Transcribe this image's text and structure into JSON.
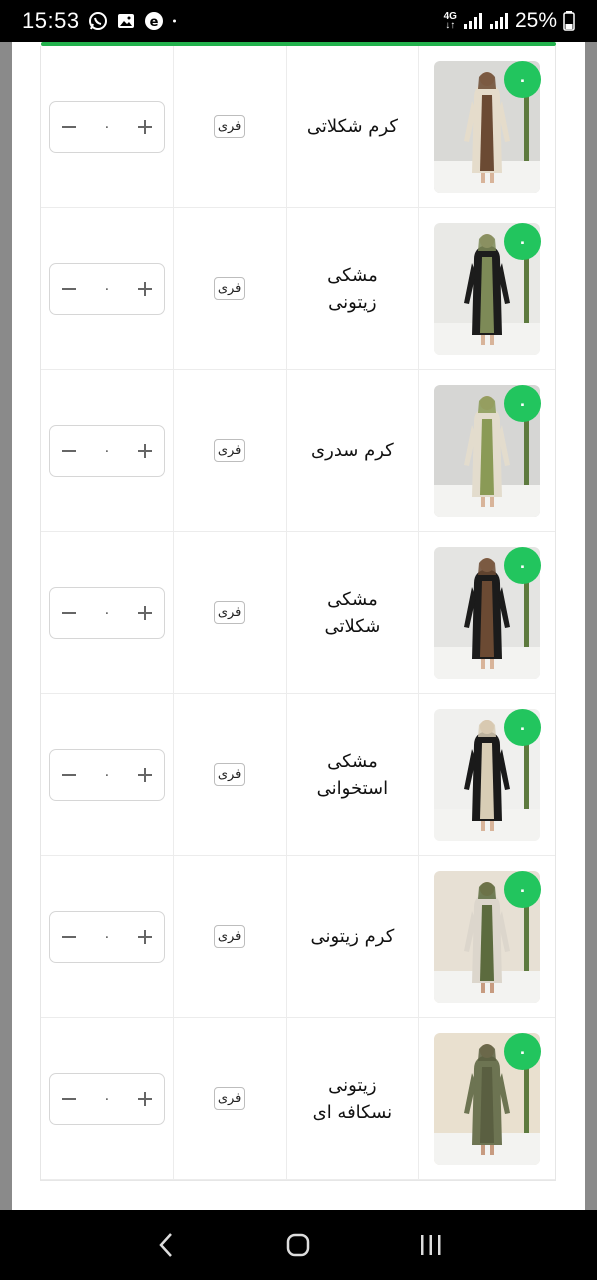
{
  "status": {
    "time": "15:53",
    "network": "4G",
    "battery": "25%"
  },
  "products": [
    {
      "name": "کرم شکلاتی",
      "size": "فری",
      "badge": "۰",
      "qty": "۰",
      "colors": {
        "bg": "#d9d9d6",
        "coat": "#e5dccb",
        "trim": "#6b4a33",
        "skin": "#d8b49a"
      }
    },
    {
      "name": "مشکی زیتونی",
      "size": "فری",
      "badge": "۰",
      "qty": "۰",
      "colors": {
        "bg": "#e9e9e6",
        "coat": "#1c1c1c",
        "trim": "#7d8a57",
        "skin": "#d8b49a"
      }
    },
    {
      "name": "کرم سدری",
      "size": "فری",
      "badge": "۰",
      "qty": "۰",
      "colors": {
        "bg": "#d6d6d4",
        "coat": "#e3dccd",
        "trim": "#8a9a56",
        "skin": "#d8b49a"
      }
    },
    {
      "name": "مشکی شکلاتی",
      "size": "فری",
      "badge": "۰",
      "qty": "۰",
      "colors": {
        "bg": "#e4e4e2",
        "coat": "#1b1b1b",
        "trim": "#6b4a33",
        "skin": "#d8b49a"
      }
    },
    {
      "name": "مشکی استخوانی",
      "size": "فری",
      "badge": "۰",
      "qty": "۰",
      "colors": {
        "bg": "#f0f0ee",
        "coat": "#1a1a1a",
        "trim": "#d8cdb5",
        "skin": "#d8b49a"
      }
    },
    {
      "name": "کرم زیتونی",
      "size": "فری",
      "badge": "۰",
      "qty": "۰",
      "colors": {
        "bg": "#e7e0d4",
        "coat": "#dcd6cc",
        "trim": "#5c6b3e",
        "skin": "#c79b80"
      }
    },
    {
      "name": "زیتونی نسکافه ای",
      "size": "فری",
      "badge": "۰",
      "qty": "۰",
      "colors": {
        "bg": "#e9e0cf",
        "coat": "#6d7452",
        "trim": "#5a5f41",
        "skin": "#c79b80"
      }
    }
  ],
  "icons": {
    "minus": "minus-icon",
    "plus": "plus-icon"
  },
  "accent": "#22b14c"
}
